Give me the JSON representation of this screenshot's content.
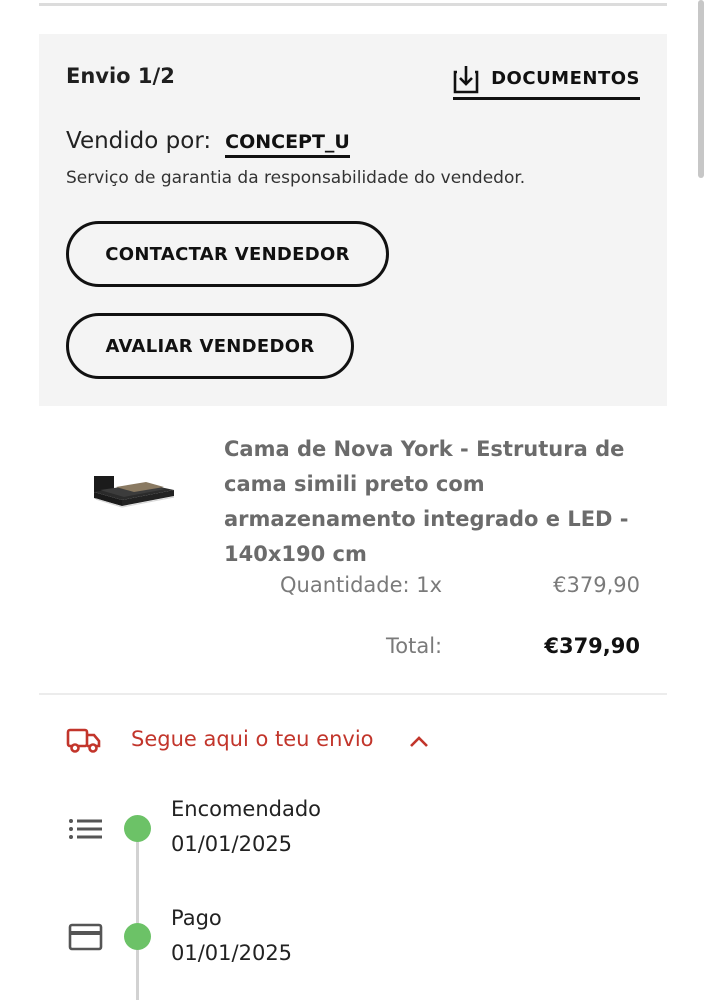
{
  "shipment": {
    "title": "Envio 1/2",
    "documents_label": "DOCUMENTOS",
    "sold_by_label": "Vendido por:",
    "seller_name": "CONCEPT_U",
    "guarantee_text": "Serviço de garantia da responsabilidade do vendedor.",
    "contact_button": "CONTACTAR VENDEDOR",
    "rate_button": "AVALIAR VENDEDOR"
  },
  "product": {
    "title": "Cama de Nova York - Estrutura de cama simili preto com armazenamento integrado e LED - 140x190 cm",
    "quantity_text": "Quantidade: 1x",
    "price": "€379,90",
    "total_label": "Total:",
    "total_value": "€379,90"
  },
  "tracking": {
    "label": "Segue aqui o teu envio",
    "steps": [
      {
        "title": "Encomendado",
        "date": "01/01/2025",
        "icon": "list-icon"
      },
      {
        "title": "Pago",
        "date": "01/01/2025",
        "icon": "credit-card-icon"
      }
    ]
  },
  "colors": {
    "accent_red": "#c2352b",
    "step_done_green": "#6cc267",
    "card_background": "#f4f4f4"
  }
}
